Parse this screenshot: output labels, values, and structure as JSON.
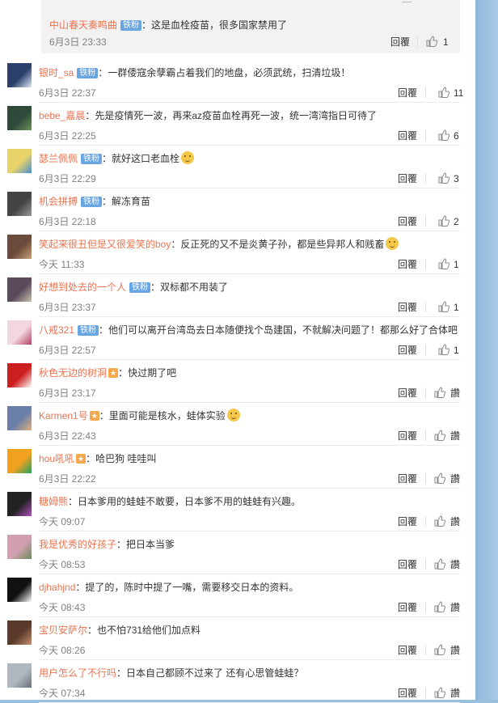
{
  "top_reply": {
    "user": "中山春天奏鸣曲",
    "badge": "铁粉",
    "text": "：这是血栓疫苗，很多国家禁用了",
    "time": "6月3日 23:33",
    "reply_label": "回覆",
    "likes": "1"
  },
  "comments": [
    {
      "user": "银时_sa",
      "badge": "铁粉",
      "text": "：一群倭寇余孽霸占着我们的地盘，必须武统，扫清垃圾！",
      "time": "6月3日 22:37",
      "reply_label": "回覆",
      "likes": "11"
    },
    {
      "user": "bebe_嘉晨",
      "badge": "",
      "text": "：先是疫情死一波，再来az疫苗血栓再死一波，统一湾湾指日可待了",
      "time": "6月3日 22:25",
      "reply_label": "回覆",
      "likes": "6"
    },
    {
      "user": "瑟兰佩佩",
      "badge": "铁粉",
      "text": "：就好这口老血栓",
      "time": "6月3日 22:29",
      "reply_label": "回覆",
      "likes": "3"
    },
    {
      "user": "机会拼搏",
      "badge": "铁粉",
      "text": "：解冻育苗",
      "time": "6月3日 22:18",
      "reply_label": "回覆",
      "likes": "2"
    },
    {
      "user": "笑起来很丑但是又很爱笑的boy",
      "badge": "",
      "text": "：反正死的又不是炎黄子孙，都是些异邦人和贱畜",
      "time": "今天 11:33",
      "reply_label": "回覆",
      "likes": "1"
    },
    {
      "user": "好想到处去的一个人",
      "badge": "铁粉",
      "text": "：双标都不用装了",
      "time": "6月3日 23:37",
      "reply_label": "回覆",
      "likes": "1"
    },
    {
      "user": "八戒321",
      "badge": "铁粉",
      "text": "：他们可以离开台湾岛去日本随便找个岛建国，不就解决问题了！都那么好了合体吧",
      "time": "6月3日 22:57",
      "reply_label": "回覆",
      "likes": "1"
    },
    {
      "user": "秋色无边的树洞",
      "badge": "",
      "text": "：快过期了吧",
      "time": "6月3日 23:17",
      "reply_label": "回覆",
      "likes": "讚"
    },
    {
      "user": "Karmen1号",
      "badge": "",
      "text": "：里面可能是核水，蛙体实验",
      "time": "6月3日 22:43",
      "reply_label": "回覆",
      "likes": "讚"
    },
    {
      "user": "hou吼吼",
      "badge": "",
      "text": "：哈巴狗 哇哇叫",
      "time": "6月3日 22:22",
      "reply_label": "回覆",
      "likes": "讚"
    },
    {
      "user": "糖姆熊",
      "badge": "",
      "text": "：日本爹用的蛙蛙不敢要，日本爹不用的蛙蛙有兴趣。",
      "time": "今天 09:07",
      "reply_label": "回覆",
      "likes": "讚"
    },
    {
      "user": "我是优秀的好孩子",
      "badge": "",
      "text": "：把日本当爹",
      "time": "今天 08:53",
      "reply_label": "回覆",
      "likes": "讚"
    },
    {
      "user": "djhahjnd",
      "badge": "",
      "text": "：提了的，陈时中提了一嘴，需要移交日本的资料。",
      "time": "今天 08:43",
      "reply_label": "回覆",
      "likes": "讚"
    },
    {
      "user": "宝贝安萨尔",
      "badge": "",
      "text": "：也不怕731给他们加点料",
      "time": "今天 08:26",
      "reply_label": "回覆",
      "likes": "讚"
    },
    {
      "user": "用户怎么了不行吗",
      "badge": "",
      "text": "：日本自己都顾不过来了 还有心思管蛙蛙？",
      "time": "今天 07:34",
      "reply_label": "回覆",
      "likes": "讚"
    }
  ],
  "colors": {
    "username": "#eb7350",
    "badge": "#69a5e0",
    "time": "#808080"
  }
}
